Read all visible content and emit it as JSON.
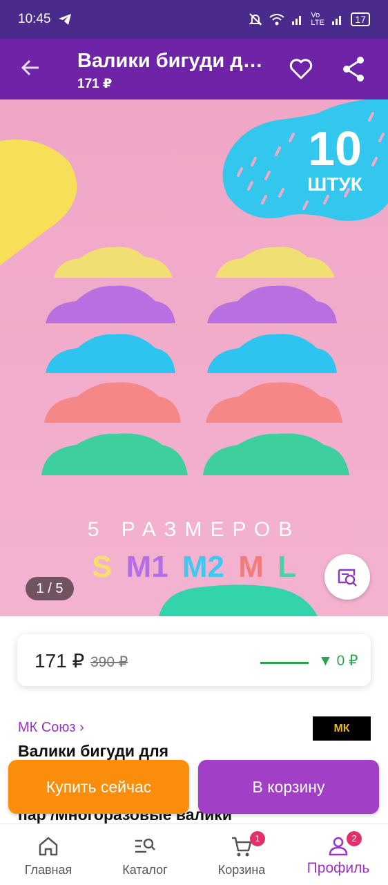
{
  "status_bar": {
    "time": "10:45",
    "network": "Vo LTE",
    "battery": "17"
  },
  "app_bar": {
    "title": "Валики бигуди д…",
    "price": "171 ₽"
  },
  "hero": {
    "badge_number": "10",
    "badge_unit": "ШТУК",
    "sizes_title": "5 РАЗМЕРОВ",
    "sizes": [
      {
        "label": "S",
        "color": "#f4e06a"
      },
      {
        "label": "M1",
        "color": "#b46ee6"
      },
      {
        "label": "M2",
        "color": "#3ec9f2"
      },
      {
        "label": "M",
        "color": "#f47b7b"
      },
      {
        "label": "L",
        "color": "#4fd0a4"
      }
    ],
    "counter": "1 / 5",
    "colors": {
      "yellow": "#f2df73",
      "purple": "#b86fe0",
      "blue": "#2fc4ef",
      "coral": "#f58787",
      "mint": "#3fcf9f",
      "badge_blob": "#33c7ed"
    }
  },
  "price_card": {
    "price": "171 ₽",
    "old_price": "390 ₽",
    "trend": "▼ 0 ₽"
  },
  "product": {
    "seller": "МК Союз ›",
    "brand_logo": "МК",
    "title_line1": "Валики бигуди для",
    "title_line2": "пар /Многоразовые валики"
  },
  "actions": {
    "buy_now": "Купить сейчас",
    "to_cart": "В корзину"
  },
  "bottom_nav": {
    "items": [
      {
        "label": "Главная",
        "icon": "home-icon"
      },
      {
        "label": "Каталог",
        "icon": "catalog-search-icon"
      },
      {
        "label": "Корзина",
        "icon": "cart-icon",
        "badge": "1"
      },
      {
        "label": "Профиль",
        "icon": "profile-icon",
        "badge": "2"
      }
    ]
  },
  "accent_colors": {
    "status_bar": "#4a2a8a",
    "app_bar": "#6f24a8",
    "brand_purple": "#9a33c4",
    "buy_orange": "#fa8e0c",
    "cart_purple": "#a13fc6",
    "trend_green": "#27a447"
  }
}
